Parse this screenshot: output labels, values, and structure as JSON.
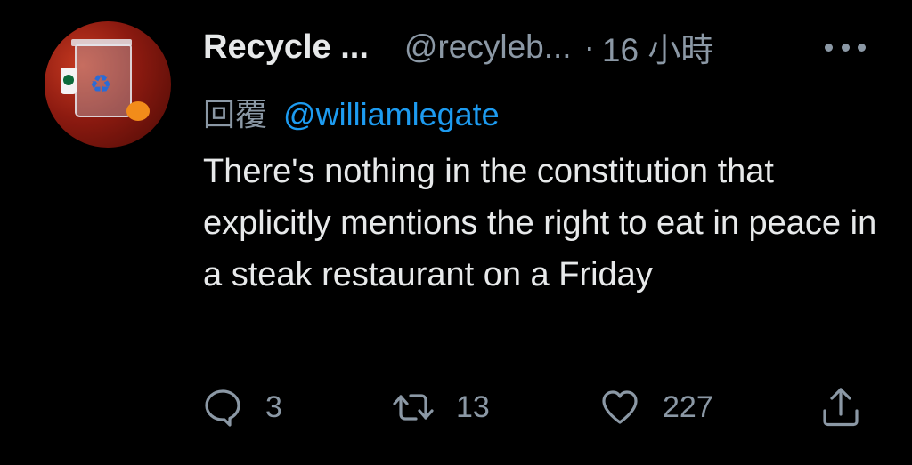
{
  "tweet": {
    "display_name": "Recycle ...",
    "handle": "@recyleb...",
    "separator": "·",
    "time": "16 小時",
    "reply_label": "回覆",
    "reply_to": "@williamlegate",
    "text": "There's nothing in the constitution that explicitly mentions the right to eat in peace in a steak restaurant on a Friday"
  },
  "actions": {
    "reply_count": "3",
    "retweet_count": "13",
    "like_count": "227"
  },
  "icons": {
    "avatar": "recycle-bin-avatar",
    "more": "more-horizontal-icon",
    "reply": "reply-bubble-icon",
    "retweet": "retweet-icon",
    "like": "heart-icon",
    "share": "share-icon"
  },
  "colors": {
    "background": "#000000",
    "text": "#e7e9ea",
    "muted": "#8b98a5",
    "link": "#1d9bf0"
  }
}
